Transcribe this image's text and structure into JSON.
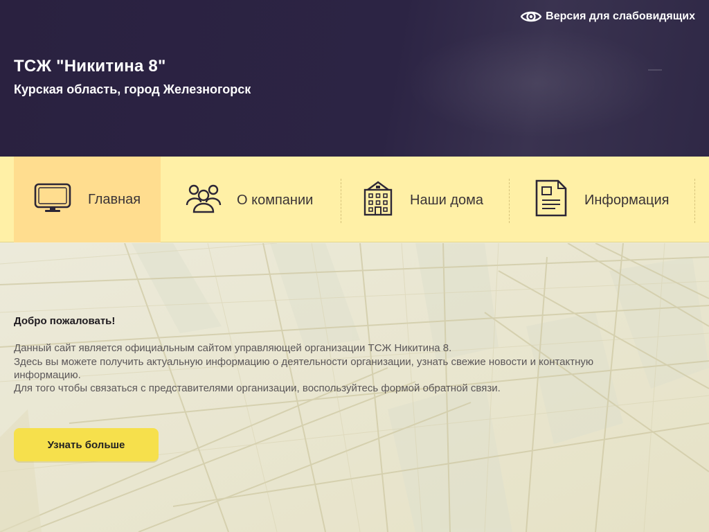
{
  "header": {
    "accessibility_label": "Версия для слабовидящих",
    "title": "ТСЖ \"Никитина 8\"",
    "region": "Курская область, город Железногорск"
  },
  "nav": {
    "items": [
      {
        "label": "Главная",
        "icon": "monitor-icon"
      },
      {
        "label": "О компании",
        "icon": "people-icon"
      },
      {
        "label": "Наши дома",
        "icon": "building-icon"
      },
      {
        "label": "Информация",
        "icon": "document-icon"
      }
    ]
  },
  "hero": {
    "welcome": "Добро пожаловать!",
    "line1": "Данный сайт является официальным сайтом управляющей организации ТСЖ Никитина 8.",
    "line2": "Здесь вы можете получить актуальную информацию о деятельности организации, узнать свежие новости и контактную информацию.",
    "line3": "Для того чтобы связаться с представителями организации, воспользуйтесь формой обратной связи.",
    "button": "Узнать больше"
  },
  "colors": {
    "header_bg": "#2a2140",
    "nav_bg": "#fff0a6",
    "nav_active": "#ffdd8f",
    "cta": "#f6e04c"
  }
}
